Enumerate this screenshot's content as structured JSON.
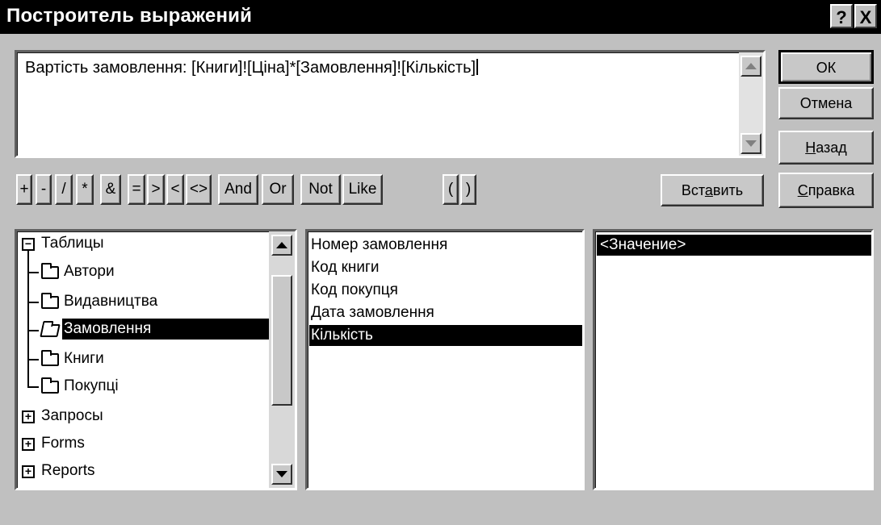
{
  "window": {
    "title": "Построитель выражений",
    "help_glyph": "?",
    "close_glyph": "X"
  },
  "expression": {
    "text": "Вартість замовлення: [Книги]![Ціна]*[Замовлення]![Кількість]"
  },
  "buttons": {
    "ok": "ОК",
    "cancel": "Отмена",
    "back_pre": "",
    "back_acc": "Н",
    "back_post": "азад",
    "help_pre": "",
    "help_acc": "С",
    "help_post": "правка",
    "insert_pre": "Вст",
    "insert_acc": "а",
    "insert_post": "вить"
  },
  "operators": [
    "+",
    "-",
    "/",
    "*",
    "&",
    "=",
    ">",
    "<",
    "<>",
    "And",
    "Or",
    "Not",
    "Like",
    "(",
    ")"
  ],
  "tree": {
    "root_label": "Таблицы",
    "children": [
      "Автори",
      "Видавництва",
      "Замовлення",
      "Книги",
      "Покупці"
    ],
    "selected_child": "Замовлення",
    "collapsed": [
      "Запросы",
      "Forms",
      "Reports"
    ]
  },
  "fields": {
    "items": [
      "Номер замовлення",
      "Код книги",
      "Код покупця",
      "Дата замовлення",
      "Кількість"
    ],
    "selected": "Кількість"
  },
  "values": {
    "items": [
      "<Значение>"
    ],
    "selected": "<Значение>"
  },
  "icons": {
    "scroll_up": "scroll-up-arrow-icon",
    "scroll_down": "scroll-down-arrow-icon",
    "folder": "folder-icon",
    "open_folder": "open-folder-icon",
    "expand": "plus-box-icon",
    "collapse": "minus-box-icon"
  }
}
